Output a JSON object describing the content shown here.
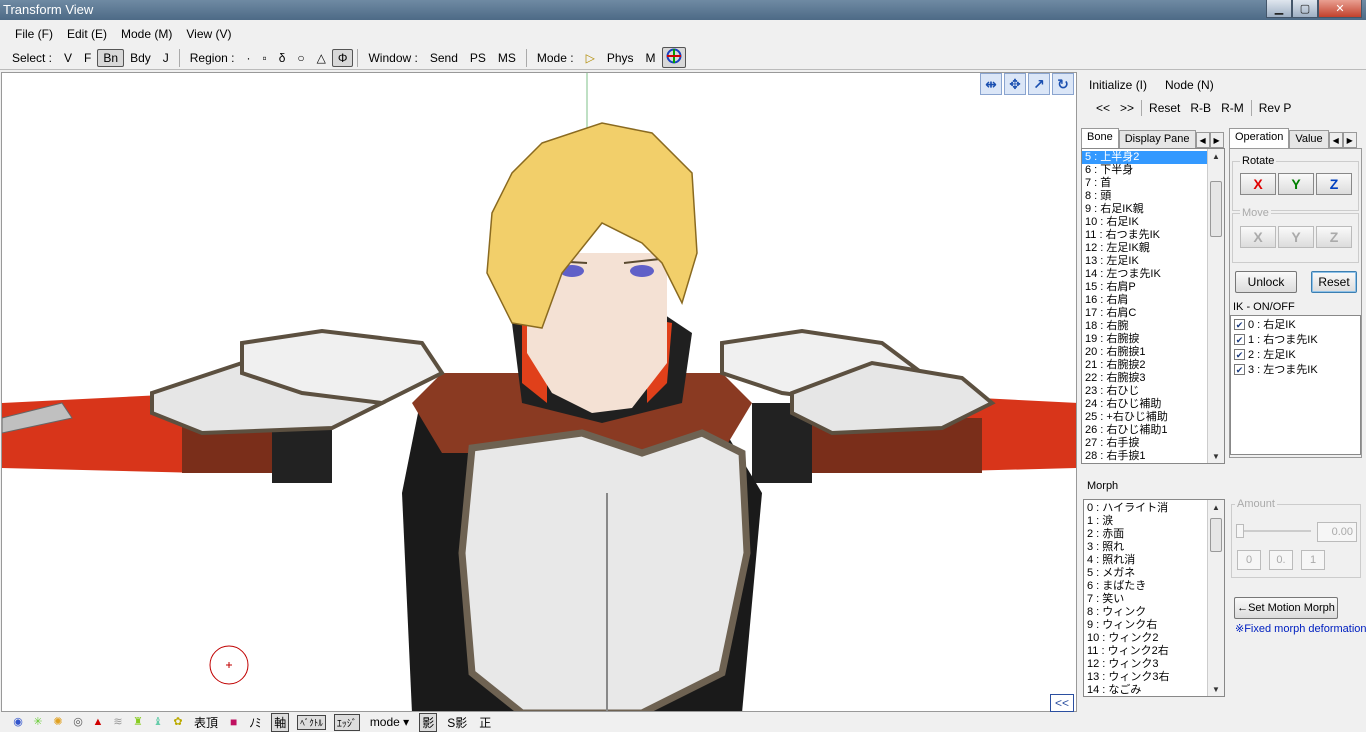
{
  "window": {
    "title": "Transform View",
    "min": "▁",
    "max": "▢",
    "close": "✕"
  },
  "menu": [
    "File (F)",
    "Edit (E)",
    "Mode (M)",
    "View (V)"
  ],
  "toolbar": {
    "select_label": "Select :",
    "select_items": [
      "V",
      "F",
      "Bn",
      "Bdy",
      "J"
    ],
    "region_label": "Region :",
    "region_items": [
      "·",
      "▫",
      "δ",
      "○",
      "△",
      "Φ"
    ],
    "window_label": "Window :",
    "window_items": [
      "Send",
      "PS",
      "MS"
    ],
    "mode_label": "Mode :",
    "mode_items": [
      "▷",
      "Phys",
      "M"
    ],
    "target_icon": "crosshair-icon"
  },
  "viewport": {
    "icons": [
      "⇹",
      "✥",
      "↗",
      "↻"
    ],
    "collapse": "<<"
  },
  "right_panel": {
    "initialize": "Initialize (I)",
    "node": "Node (N)",
    "nav": [
      "<<",
      ">>",
      "Reset",
      "R-B",
      "R-M",
      "Rev P"
    ],
    "bone_tab": "Bone",
    "display_tab": "Display Pane",
    "operation_tab": "Operation",
    "value_tab": "Value",
    "bones": [
      "5 : 上半身2",
      "6 : 下半身",
      "7 : 首",
      "8 : 頭",
      "9 : 右足IK親",
      "10 : 右足IK",
      "11 : 右つま先IK",
      "12 : 左足IK親",
      "13 : 左足IK",
      "14 : 左つま先IK",
      "15 : 右肩P",
      "16 : 右肩",
      "17 : 右肩C",
      "18 : 右腕",
      "19 : 右腕捩",
      "20 : 右腕捩1",
      "21 : 右腕捩2",
      "22 : 右腕捩3",
      "23 : 右ひじ",
      "24 : 右ひじ補助",
      "25 : +右ひじ補助",
      "26 : 右ひじ補助1",
      "27 : 右手捩",
      "28 : 右手捩1"
    ],
    "rotate_label": "Rotate",
    "move_label": "Move",
    "axes": [
      "X",
      "Y",
      "Z"
    ],
    "axis_colors": {
      "x": "#e00000",
      "y": "#008000",
      "z": "#0040c0"
    },
    "unlock": "Unlock",
    "reset": "Reset",
    "ik_label": "IK - ON/OFF",
    "ik_items": [
      "0 : 右足IK",
      "1 : 右つま先IK",
      "2 : 左足IK",
      "3 : 左つま先IK"
    ],
    "morph_label": "Morph",
    "morphs": [
      "0 : ハイライト消",
      "1 : 涙",
      "2 : 赤面",
      "3 : 照れ",
      "4 : 照れ消",
      "5 : メガネ",
      "6 : まばたき",
      "7 : 笑い",
      "8 : ウィンク",
      "9 : ウィンク右",
      "10 : ウィンク2",
      "11 : ウィンク2右",
      "12 : ウィンク3",
      "13 : ウィンク3右",
      "14 : なごみ"
    ],
    "amount_label": "Amount",
    "amount_value": "0.00",
    "amount_buttons": [
      "0",
      "0.",
      "1"
    ],
    "set_motion_morph": "←Set Motion Morph",
    "fixed_morph": "※Fixed morph deformation"
  },
  "bottom": {
    "icons": [
      "◉",
      "✳",
      "✺",
      "◎",
      "▲",
      "≋",
      "♜",
      "♝",
      "✿"
    ],
    "texts": [
      "表頂",
      "■",
      "ﾉﾐ",
      "軸",
      "ﾍﾞｸﾄﾙ",
      "ｴｯｼﾞ",
      "mode ▾",
      "影",
      "S影",
      "正"
    ]
  }
}
